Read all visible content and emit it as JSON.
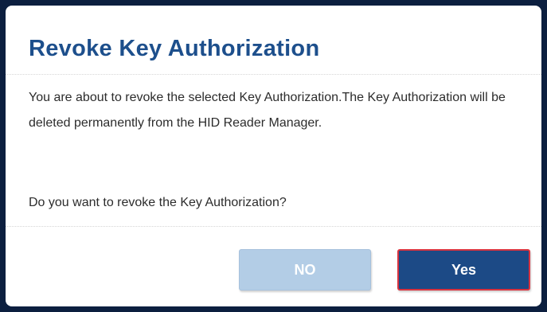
{
  "dialog": {
    "title": "Revoke Key Authorization",
    "message": "You are about to revoke the selected Key Authorization.The Key Authorization will be deleted permanently from the HID Reader Manager.",
    "question": "Do you want to revoke the Key Authorization?",
    "buttons": {
      "no_label": "NO",
      "yes_label": "Yes"
    }
  },
  "colors": {
    "title": "#1d4f8c",
    "primary_button": "#1c4a86",
    "primary_button_border": "#d9333f",
    "secondary_button": "#b3cde6",
    "backdrop": "#0c1f3f"
  }
}
